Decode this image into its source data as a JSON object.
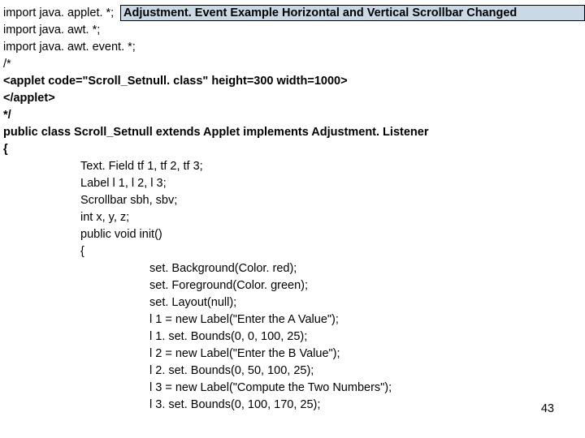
{
  "title": "Adjustment. Event Example Horizontal and Vertical Scrollbar Changed",
  "lines": {
    "l1": "import java. applet. *;",
    "l2": "import java. awt. *;",
    "l3": "import java. awt. event. *;",
    "l4": "/*",
    "l5": "<applet code=\"Scroll_Setnull. class\" height=300 width=1000>",
    "l6": "</applet>",
    "l7": "*/",
    "l8": "public class Scroll_Setnull extends Applet implements Adjustment. Listener",
    "l9": "{",
    "l10": "Text. Field tf 1, tf 2, tf 3;",
    "l11": "Label l 1, l 2, l 3;",
    "l12": "Scrollbar sbh, sbv;",
    "l13": "int x, y, z;",
    "l14": "public void init()",
    "l15": "{",
    "l16": "set. Background(Color. red);",
    "l17": "set. Foreground(Color. green);",
    "l18": "set. Layout(null);",
    "l19": "l 1 = new Label(\"Enter the A Value\");",
    "l20": "l 1. set. Bounds(0, 0, 100, 25);",
    "l21": "l 2 = new Label(\"Enter the B Value\");",
    "l22": "l 2. set. Bounds(0, 50, 100, 25);",
    "l23": "l 3 = new Label(\"Compute the Two Numbers\");",
    "l24": "l 3. set. Bounds(0, 100, 170, 25);"
  },
  "page_number": "43"
}
